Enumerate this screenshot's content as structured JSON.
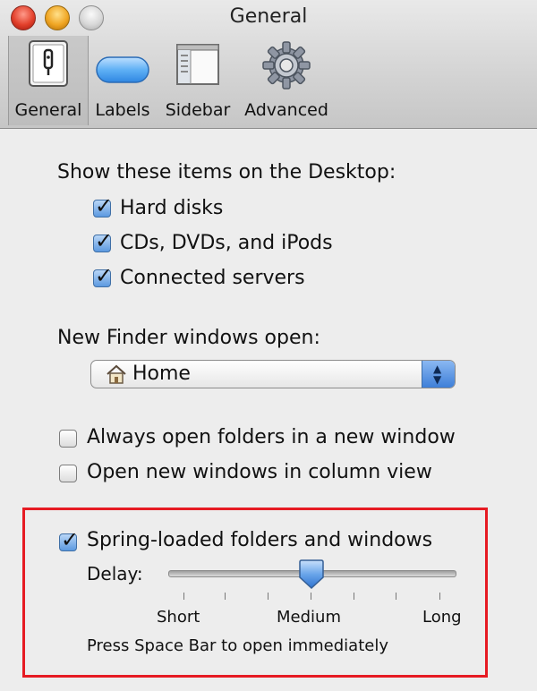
{
  "window": {
    "title": "General"
  },
  "toolbar": {
    "items": [
      {
        "label": "General",
        "icon": "general-prefs-icon",
        "selected": true
      },
      {
        "label": "Labels",
        "icon": "labels-icon",
        "selected": false
      },
      {
        "label": "Sidebar",
        "icon": "sidebar-icon",
        "selected": false
      },
      {
        "label": "Advanced",
        "icon": "gear-icon",
        "selected": false
      }
    ]
  },
  "desktop": {
    "heading": "Show these items on the Desktop:",
    "items": [
      {
        "label": "Hard disks",
        "checked": true
      },
      {
        "label": "CDs, DVDs, and iPods",
        "checked": true
      },
      {
        "label": "Connected servers",
        "checked": true
      }
    ]
  },
  "new_window": {
    "heading": "New Finder windows open:",
    "selected": "Home"
  },
  "options": {
    "items": [
      {
        "label": "Always open folders in a new window",
        "checked": false
      },
      {
        "label": "Open new windows in column view",
        "checked": false
      }
    ]
  },
  "spring": {
    "label": "Spring-loaded folders and windows",
    "checked": true,
    "delay_label": "Delay:",
    "delay_value_fraction": 0.5,
    "ticks": [
      "Short",
      "Medium",
      "Long"
    ],
    "hint": "Press Space Bar to open immediately"
  },
  "colors": {
    "highlight_box": "#e61b23",
    "checkbox_on": "#5c99e0"
  }
}
